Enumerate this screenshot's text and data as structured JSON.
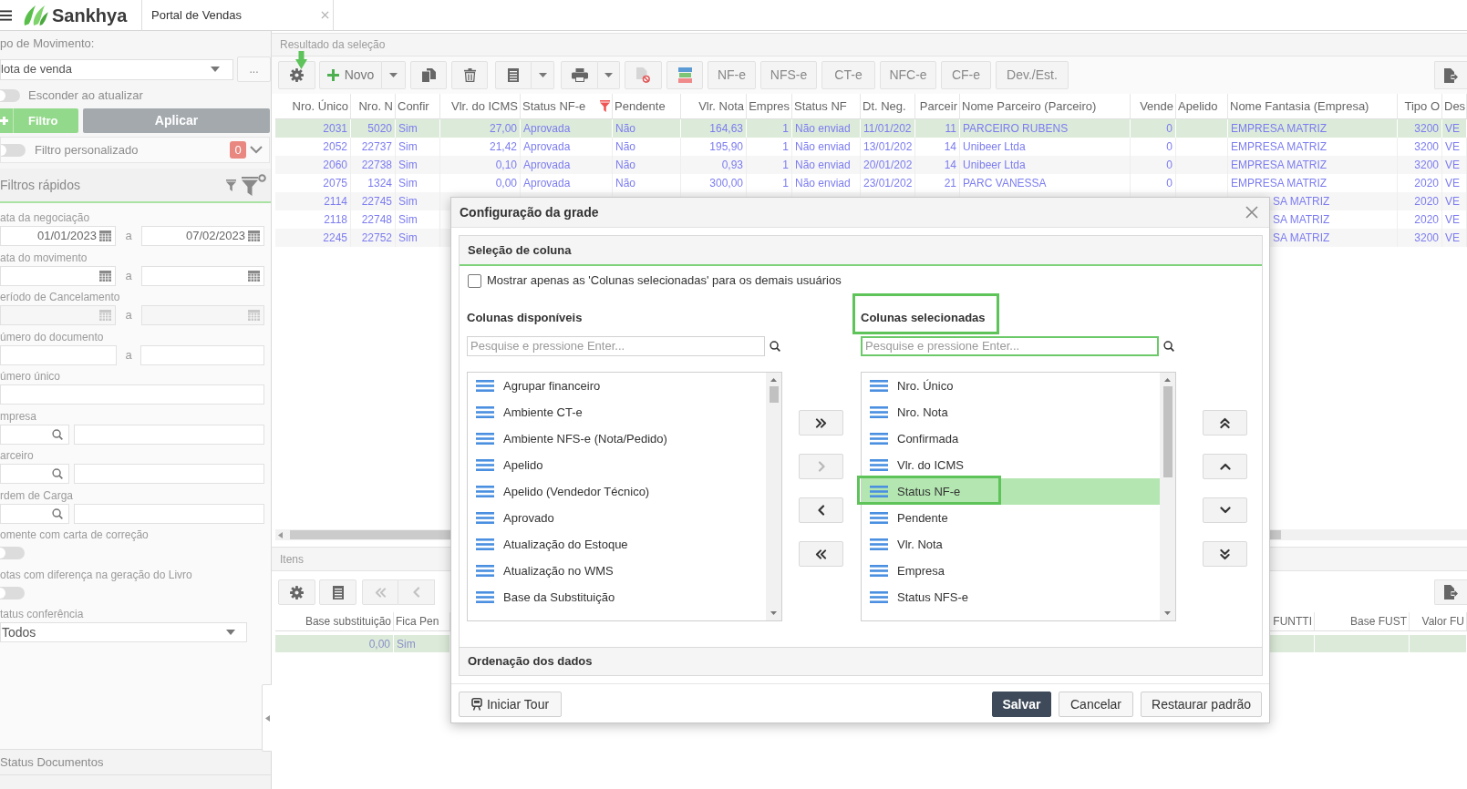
{
  "app_bar": {
    "logo": "Sankhya",
    "tab": {
      "label": "Portal de Vendas"
    }
  },
  "sidebar": {
    "movement_type": {
      "label": "po de Movimento:",
      "value": "lota de venda",
      "more_button": "..."
    },
    "hide_on_update": {
      "label": "Esconder ao atualizar",
      "on": false
    },
    "filter_button": "Filtro",
    "apply_button": "Aplicar",
    "custom_filter": {
      "label": "Filtro personalizado",
      "on": false,
      "count": "0"
    },
    "quick_filters": {
      "title": "Filtros rápidos",
      "fields": [
        {
          "kind": "date_range",
          "label": "ata da negociação",
          "from": "01/01/2023",
          "separator": "a",
          "to": "07/02/2023",
          "disabled": false
        },
        {
          "kind": "date_range",
          "label": "ata do movimento",
          "separator": "a",
          "disabled": false
        },
        {
          "kind": "date_range",
          "label": "eríodo de Cancelamento",
          "separator": "a",
          "disabled": true
        },
        {
          "kind": "range",
          "label": "úmero do documento",
          "separator": "a"
        },
        {
          "kind": "text",
          "label": "úmero único"
        },
        {
          "kind": "lookup",
          "label": "mpresa"
        },
        {
          "kind": "lookup",
          "label": "arceiro"
        },
        {
          "kind": "lookup",
          "label": "rdem de Carga"
        },
        {
          "kind": "toggle",
          "label": "omente com carta de correção",
          "on": false,
          "disabled": false
        },
        {
          "kind": "toggle",
          "label": "otas com diferença na geração do Livro",
          "on": false,
          "disabled": false
        },
        {
          "kind": "select",
          "label": "tatus conferência",
          "value": "Todos"
        }
      ]
    },
    "status_documents": {
      "title": "Status Documentos"
    }
  },
  "results": {
    "title": "Resultado da seleção",
    "toolbar": {
      "new_button": "Novo",
      "document_buttons": [
        "NF-e",
        "NFS-e",
        "CT-e",
        "NFC-e",
        "CF-e",
        "Dev./Est."
      ]
    },
    "table": {
      "columns": [
        {
          "label": "Nro. Único",
          "kind": "number",
          "filtered": false
        },
        {
          "label": "Nro. N",
          "kind": "number",
          "filtered": false
        },
        {
          "label": "Confir",
          "kind": "text",
          "filtered": false
        },
        {
          "label": "Vlr. do ICMS",
          "kind": "number",
          "filtered": false
        },
        {
          "label": "Status NF-e",
          "kind": "text",
          "filtered": true
        },
        {
          "label": "Pendente",
          "kind": "text",
          "filtered": false
        },
        {
          "label": "Vlr. Nota",
          "kind": "number",
          "filtered": false
        },
        {
          "label": "Empres",
          "kind": "number",
          "filtered": false
        },
        {
          "label": "Status NF",
          "kind": "text",
          "filtered": false
        },
        {
          "label": "Dt. Neg.",
          "kind": "text",
          "filtered": false
        },
        {
          "label": "Parceir",
          "kind": "number",
          "filtered": false
        },
        {
          "label": "Nome Parceiro (Parceiro)",
          "kind": "text",
          "filtered": false
        },
        {
          "label": "Vende",
          "kind": "number",
          "filtered": false
        },
        {
          "label": "Apelido",
          "kind": "text",
          "filtered": false
        },
        {
          "label": "Nome Fantasia (Empresa)",
          "kind": "text",
          "filtered": false
        },
        {
          "label": "Tipo O",
          "kind": "number",
          "filtered": false
        },
        {
          "label": "Des",
          "kind": "text",
          "filtered": false
        }
      ],
      "rows": [
        {
          "selected": true,
          "cells": [
            "2031",
            "5020",
            "Sim",
            "27,00",
            "Aprovada",
            "Não",
            "164,63",
            "1",
            "Não enviad",
            "11/01/202",
            "11",
            "PARCEIRO RUBENS",
            "0",
            null,
            "EMPRESA MATRIZ",
            "3200",
            "VE"
          ]
        },
        {
          "selected": false,
          "cells": [
            "2052",
            "22737",
            "Sim",
            "21,42",
            "Aprovada",
            "Não",
            "195,90",
            "1",
            "Não enviad",
            "13/01/202",
            "14",
            "Unibeer Ltda",
            "0",
            null,
            "EMPRESA MATRIZ",
            "3200",
            "VE"
          ]
        },
        {
          "selected": false,
          "cells": [
            "2060",
            "22738",
            "Sim",
            "0,10",
            "Aprovada",
            "Não",
            "0,93",
            "1",
            "Não enviad",
            "20/01/202",
            "14",
            "Unibeer Ltda",
            "0",
            null,
            "EMPRESA MATRIZ",
            "3200",
            "VE"
          ]
        },
        {
          "selected": false,
          "cells": [
            "2075",
            "1324",
            "Sim",
            "0,00",
            "Aprovada",
            "Não",
            "300,00",
            "1",
            "Não enviad",
            "23/01/202",
            "21",
            "PARC VANESSA",
            "0",
            null,
            "EMPRESA MATRIZ",
            "2020",
            "VE"
          ]
        },
        {
          "selected": false,
          "cells": [
            "2114",
            "22745",
            "Sim",
            null,
            null,
            null,
            null,
            null,
            null,
            null,
            null,
            null,
            null,
            null,
            "SA MATRIZ",
            "2020",
            "VE"
          ]
        },
        {
          "selected": false,
          "cells": [
            "2118",
            "22748",
            "Sim",
            null,
            null,
            null,
            null,
            null,
            null,
            null,
            null,
            null,
            null,
            null,
            "SA MATRIZ",
            "2020",
            "VE"
          ]
        },
        {
          "selected": false,
          "cells": [
            "2245",
            "22752",
            "Sim",
            null,
            null,
            null,
            null,
            null,
            null,
            null,
            null,
            null,
            null,
            null,
            "SA MATRIZ",
            "3200",
            "VE"
          ]
        }
      ]
    }
  },
  "items": {
    "title": "Itens",
    "nav_buttons": [
      {
        "kind": "first",
        "disabled": true
      },
      {
        "kind": "previous",
        "disabled": true
      }
    ],
    "table": {
      "columns": [
        {
          "label": "Base substituição",
          "kind": "number"
        },
        {
          "label": "Fica Pen",
          "kind": "text"
        },
        {
          "label": "FUNTTI",
          "kind": "number"
        },
        {
          "label": "Base FUST",
          "kind": "number"
        },
        {
          "label": "Valor FU",
          "kind": "number"
        }
      ],
      "rows": [
        {
          "selected": true,
          "cells": [
            "0,00",
            "Sim",
            null,
            null,
            null
          ]
        }
      ]
    }
  },
  "dialog": {
    "title": "Configuração da grade",
    "column_selection": {
      "title": "Seleção de coluna",
      "show_only_selected": {
        "label": "Mostrar apenas as 'Colunas selecionadas' para os demais usuários",
        "checked": false
      },
      "lists": [
        {
          "title": "Colunas disponíveis",
          "highlighted": false,
          "search": {
            "placeholder": "Pesquise e pressione Enter...",
            "focused": false
          },
          "items": [
            {
              "label": "Agrupar financeiro",
              "selected": false,
              "highlighted": false
            },
            {
              "label": "Ambiente CT-e",
              "selected": false,
              "highlighted": false
            },
            {
              "label": "Ambiente NFS-e (Nota/Pedido)",
              "selected": false,
              "highlighted": false
            },
            {
              "label": "Apelido",
              "selected": false,
              "highlighted": false
            },
            {
              "label": "Apelido (Vendedor Técnico)",
              "selected": false,
              "highlighted": false
            },
            {
              "label": "Aprovado",
              "selected": false,
              "highlighted": false
            },
            {
              "label": "Atualização do Estoque",
              "selected": false,
              "highlighted": false
            },
            {
              "label": "Atualização no WMS",
              "selected": false,
              "highlighted": false
            },
            {
              "label": "Base da Substituição",
              "selected": false,
              "highlighted": false
            }
          ]
        },
        {
          "title": "Colunas selecionadas",
          "highlighted": true,
          "search": {
            "placeholder": "Pesquise e pressione Enter...",
            "focused": true
          },
          "items": [
            {
              "label": "Nro. Único",
              "selected": false,
              "highlighted": false
            },
            {
              "label": "Nro. Nota",
              "selected": false,
              "highlighted": false
            },
            {
              "label": "Confirmada",
              "selected": false,
              "highlighted": false
            },
            {
              "label": "Vlr. do ICMS",
              "selected": false,
              "highlighted": false
            },
            {
              "label": "Status NF-e",
              "selected": true,
              "highlighted": true
            },
            {
              "label": "Pendente",
              "selected": false,
              "highlighted": false
            },
            {
              "label": "Vlr. Nota",
              "selected": false,
              "highlighted": false
            },
            {
              "label": "Empresa",
              "selected": false,
              "highlighted": false
            },
            {
              "label": "Status NFS-e",
              "selected": false,
              "highlighted": false
            }
          ]
        }
      ],
      "transfer_buttons": [
        {
          "kind": "add_all",
          "disabled": false
        },
        {
          "kind": "add",
          "disabled": true
        },
        {
          "kind": "remove",
          "disabled": false
        },
        {
          "kind": "remove_all",
          "disabled": false
        }
      ],
      "order_buttons": [
        {
          "kind": "top",
          "disabled": false
        },
        {
          "kind": "up",
          "disabled": false
        },
        {
          "kind": "down",
          "disabled": false
        },
        {
          "kind": "bottom",
          "disabled": false
        }
      ]
    },
    "data_ordering": {
      "title": "Ordenação dos dados"
    },
    "tour_button": "Iniciar Tour",
    "actions": [
      {
        "label": "Salvar",
        "kind": "primary"
      },
      {
        "label": "Cancelar",
        "kind": "secondary"
      },
      {
        "label": "Restaurar padrão",
        "kind": "secondary"
      }
    ]
  }
}
